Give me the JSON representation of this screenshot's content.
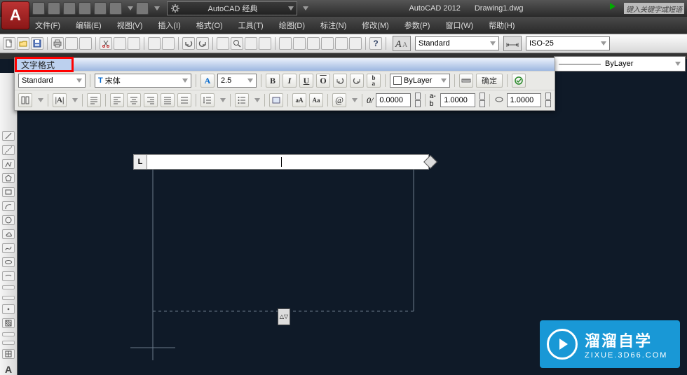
{
  "app": {
    "name": "AutoCAD 2012",
    "doc": "Drawing1.dwg",
    "search_ph": "键入关键字或短语"
  },
  "workspace": {
    "label": "AutoCAD 经典"
  },
  "menu": [
    "文件(F)",
    "编辑(E)",
    "视图(V)",
    "插入(I)",
    "格式(O)",
    "工具(T)",
    "绘图(D)",
    "标注(N)",
    "修改(M)",
    "参数(P)",
    "窗口(W)",
    "帮助(H)"
  ],
  "toolbar": {
    "style_sel": "Standard",
    "dim_sel": "ISO-25",
    "bylayer": "ByLayer"
  },
  "txtfx": {
    "title": "文字格式",
    "style": "Standard",
    "font": "宋体",
    "font_prefix": "T",
    "height": "2.5",
    "bylayer": "ByLayer",
    "ok": "确定",
    "obl": "0.0000",
    "track": "1.0000",
    "widthf": "1.0000",
    "at": "@",
    "zeroslash": "0/"
  },
  "mtext": {
    "corner_label": "L",
    "arrows": "△▽"
  },
  "watermark": {
    "brand": "溜溜自学",
    "url": "ZIXUE.3D66.COM"
  }
}
